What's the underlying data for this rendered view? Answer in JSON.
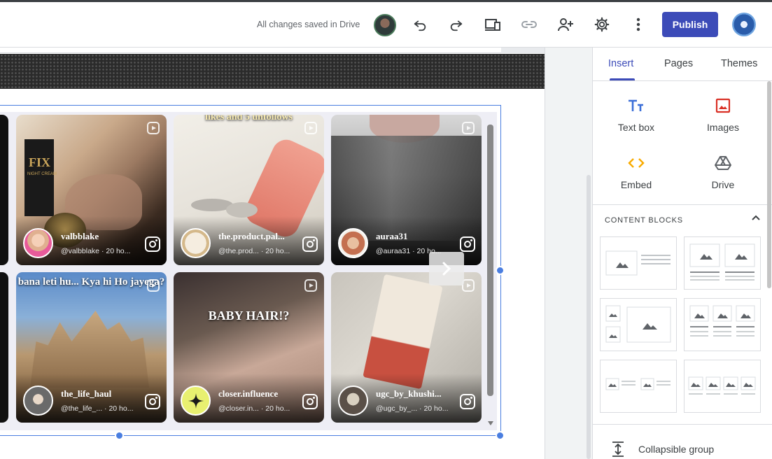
{
  "toolbar": {
    "status": "All changes saved in Drive",
    "publish_label": "Publish",
    "icons": [
      "undo-icon",
      "redo-icon",
      "preview-icon",
      "link-icon",
      "share-icon",
      "settings-icon",
      "more-icon"
    ]
  },
  "feed": {
    "posts": [
      {
        "username": "valbblake",
        "handle": "@valbblake",
        "time": "20 ho..."
      },
      {
        "username": "the.product.pal...",
        "handle": "@the.prod...",
        "time": "20 ho..."
      },
      {
        "username": "auraa31",
        "handle": "@auraa31",
        "time": "20 ho..."
      },
      {
        "username": "the_life_haul",
        "handle": "@the_life_...",
        "time": "20 ho..."
      },
      {
        "username": "closer.influence",
        "handle": "@closer.in...",
        "time": "20 ho..."
      },
      {
        "username": "ugc_by_khushi...",
        "handle": "@ugc_by_...",
        "time": "20 ho..."
      }
    ],
    "overlays": {
      "top_caption": "likes and 5 unfollows",
      "bana": "bana leti hu... Kya hi Ho jayega?",
      "baby_hair": "BABY HAIR!?",
      "fix_label": "FIX",
      "night_cream": "NIGHT CREAM"
    }
  },
  "panel": {
    "tabs": [
      "Insert",
      "Pages",
      "Themes"
    ],
    "insert_items": [
      {
        "label": "Text box",
        "icon": "text-box-icon"
      },
      {
        "label": "Images",
        "icon": "image-icon"
      },
      {
        "label": "Embed",
        "icon": "embed-icon"
      },
      {
        "label": "Drive",
        "icon": "drive-icon"
      }
    ],
    "content_blocks_title": "CONTENT BLOCKS",
    "collapsible_group": "Collapsible group"
  },
  "colors": {
    "accent": "#3c4bb8",
    "selection": "#4a7ee0",
    "images_icon": "#d93025",
    "embed_icon": "#f9ab00"
  }
}
